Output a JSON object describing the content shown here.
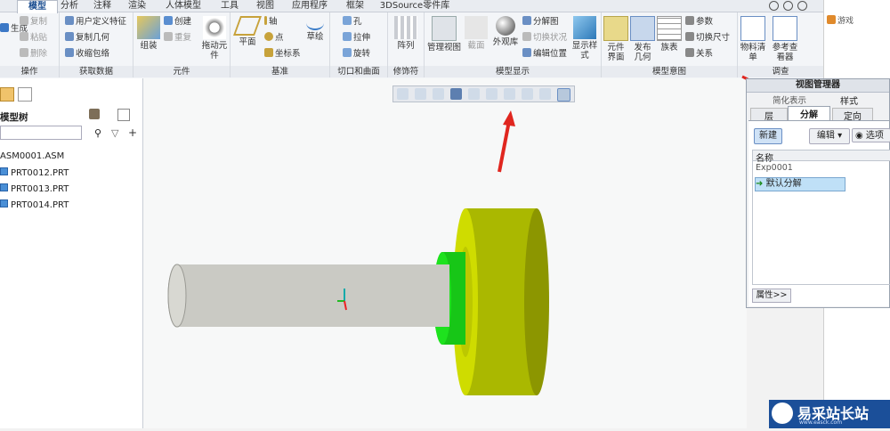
{
  "tabs": [
    "模型",
    "分析",
    "注释",
    "渲染",
    "人体模型",
    "工具",
    "视图",
    "应用程序",
    "框架",
    "3DSource零件库"
  ],
  "groups": {
    "operations": "操作",
    "get_data": "获取数据",
    "component": "元件",
    "datum": "基准",
    "cut_surface": "切口和曲面",
    "modifier": "修饰符",
    "model_display": "模型显示",
    "model_intent": "模型意图",
    "investigate": "调查"
  },
  "buttons": {
    "regenerate": "生成",
    "copy": "复制",
    "paste": "粘贴",
    "delete": "删除",
    "udf": "用户定义特征",
    "copy_geom": "复制几何",
    "shrinkwrap": "收缩包络",
    "assemble": "组装",
    "create": "创建",
    "redo": "重复",
    "drag": "拖动元件",
    "plane": "平面",
    "axis": "轴",
    "point": "点",
    "csys": "坐标系",
    "sketch": "草绘",
    "hole": "孔",
    "extrude": "拉伸",
    "revolve": "旋转",
    "pattern": "阵列",
    "manage_views": "管理视图",
    "section": "截面",
    "appearance": "外观库",
    "explode": "分解图",
    "toggle_state": "切换状况",
    "edit_position": "编辑位置",
    "display_style": "显示样式",
    "comp_interface": "元件界面",
    "publish_geom": "发布几何",
    "family_table": "族表",
    "params": "参数",
    "switch_dims": "切换尺寸",
    "relations": "关系",
    "bom": "物料清单",
    "ref_viewer": "参考查看器"
  },
  "right_strip": {
    "games": "游戏"
  },
  "tree": {
    "title": "模型树",
    "items": [
      "ASM0001.ASM",
      "PRT0012.PRT",
      "PRT0013.PRT",
      "PRT0014.PRT"
    ]
  },
  "view_manager": {
    "title": "视图管理器",
    "top_tabs": [
      "简化表示",
      "样式"
    ],
    "tabs": [
      "层",
      "分解",
      "定向"
    ],
    "new_btn": "新建",
    "edit_btn": "编辑",
    "options_btn": "选项",
    "col_name": "名称",
    "rows": [
      "Exp0001",
      "默认分解"
    ],
    "props_btn": "属性>>"
  },
  "watermark": {
    "text": "易采站长站",
    "sub": "www.easck.com"
  },
  "colors": {
    "accent": "#1d4f91",
    "yellow_part": "#c8d400",
    "green_part": "#18d418",
    "shaft": "#c9c9c3",
    "arrow": "#e0261f"
  }
}
